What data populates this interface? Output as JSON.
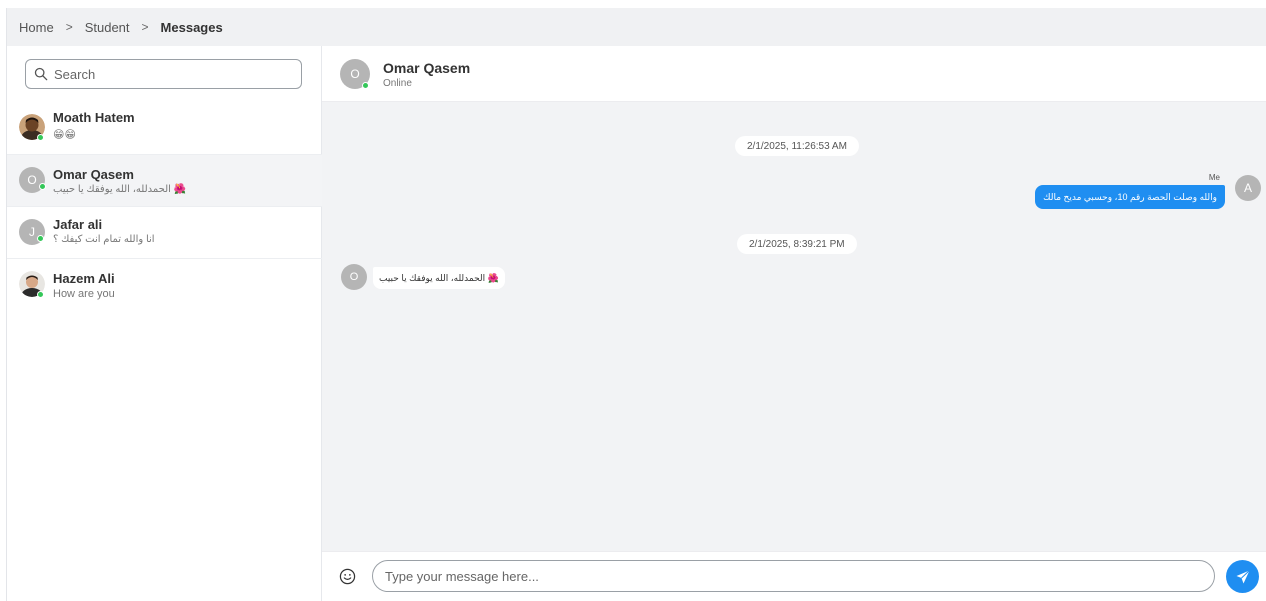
{
  "breadcrumb": {
    "items": [
      "Home",
      "Student"
    ],
    "current": "Messages"
  },
  "sidebar": {
    "search_placeholder": "Search",
    "contacts": [
      {
        "name": "Moath Hatem",
        "preview": "😁😁",
        "online": true,
        "avatar": "photo"
      },
      {
        "name": "Omar Qasem",
        "preview": "الحمدلله، الله يوفقك يا حبيب 🌺",
        "online": true,
        "avatar": "O",
        "active": true
      },
      {
        "name": "Jafar ali",
        "preview": "انا والله تمام انت كيفك ؟",
        "online": true,
        "avatar": "J"
      },
      {
        "name": "Hazem Ali",
        "preview": "How are you",
        "online": true,
        "avatar": "photo"
      }
    ]
  },
  "chat": {
    "contact_name": "Omar Qasem",
    "contact_status": "Online",
    "contact_initial": "O",
    "messages": [
      {
        "date": "2/1/2025, 11:26:53 AM",
        "sender_label": "Me",
        "sender_initial": "A",
        "text": "والله وصلت الحصة رقم 10، وحسبي مديح مالك"
      },
      {
        "date": "2/1/2025, 8:39:21 PM",
        "sender_initial": "O",
        "text": "الحمدلله، الله يوفقك يا حبيب 🌺"
      }
    ],
    "input_placeholder": "Type your message here..."
  },
  "colors": {
    "accent": "#1f8ef1",
    "online": "#34c759",
    "avatar_placeholder": "#b5b5b5"
  },
  "icons": {
    "search": "search-icon",
    "emoji": "smiley-icon",
    "send": "paper-plane-icon",
    "chevron": "chevron-right-icon"
  }
}
